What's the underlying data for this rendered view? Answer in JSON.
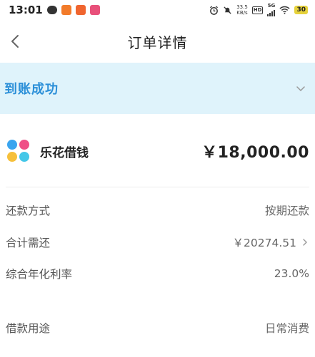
{
  "status_bar": {
    "time": "13:01",
    "net_speed_value": "33.5",
    "net_speed_unit": "KB/s",
    "hd": "HD",
    "network": "5G",
    "battery": "30"
  },
  "nav": {
    "title": "订单详情"
  },
  "banner": {
    "status_text": "到账成功"
  },
  "product": {
    "name": "乐花借钱",
    "amount": "￥18,000.00"
  },
  "details": [
    {
      "label": "还款方式",
      "value": "按期还款"
    },
    {
      "label": "合计需还",
      "value": "￥20274.51"
    },
    {
      "label": "综合年化利率",
      "value": "23.0%"
    },
    {
      "label": "借款用途",
      "value": "日常消费"
    }
  ],
  "colors": {
    "banner_bg": "#dff3fb",
    "banner_text": "#2b8fd8"
  }
}
